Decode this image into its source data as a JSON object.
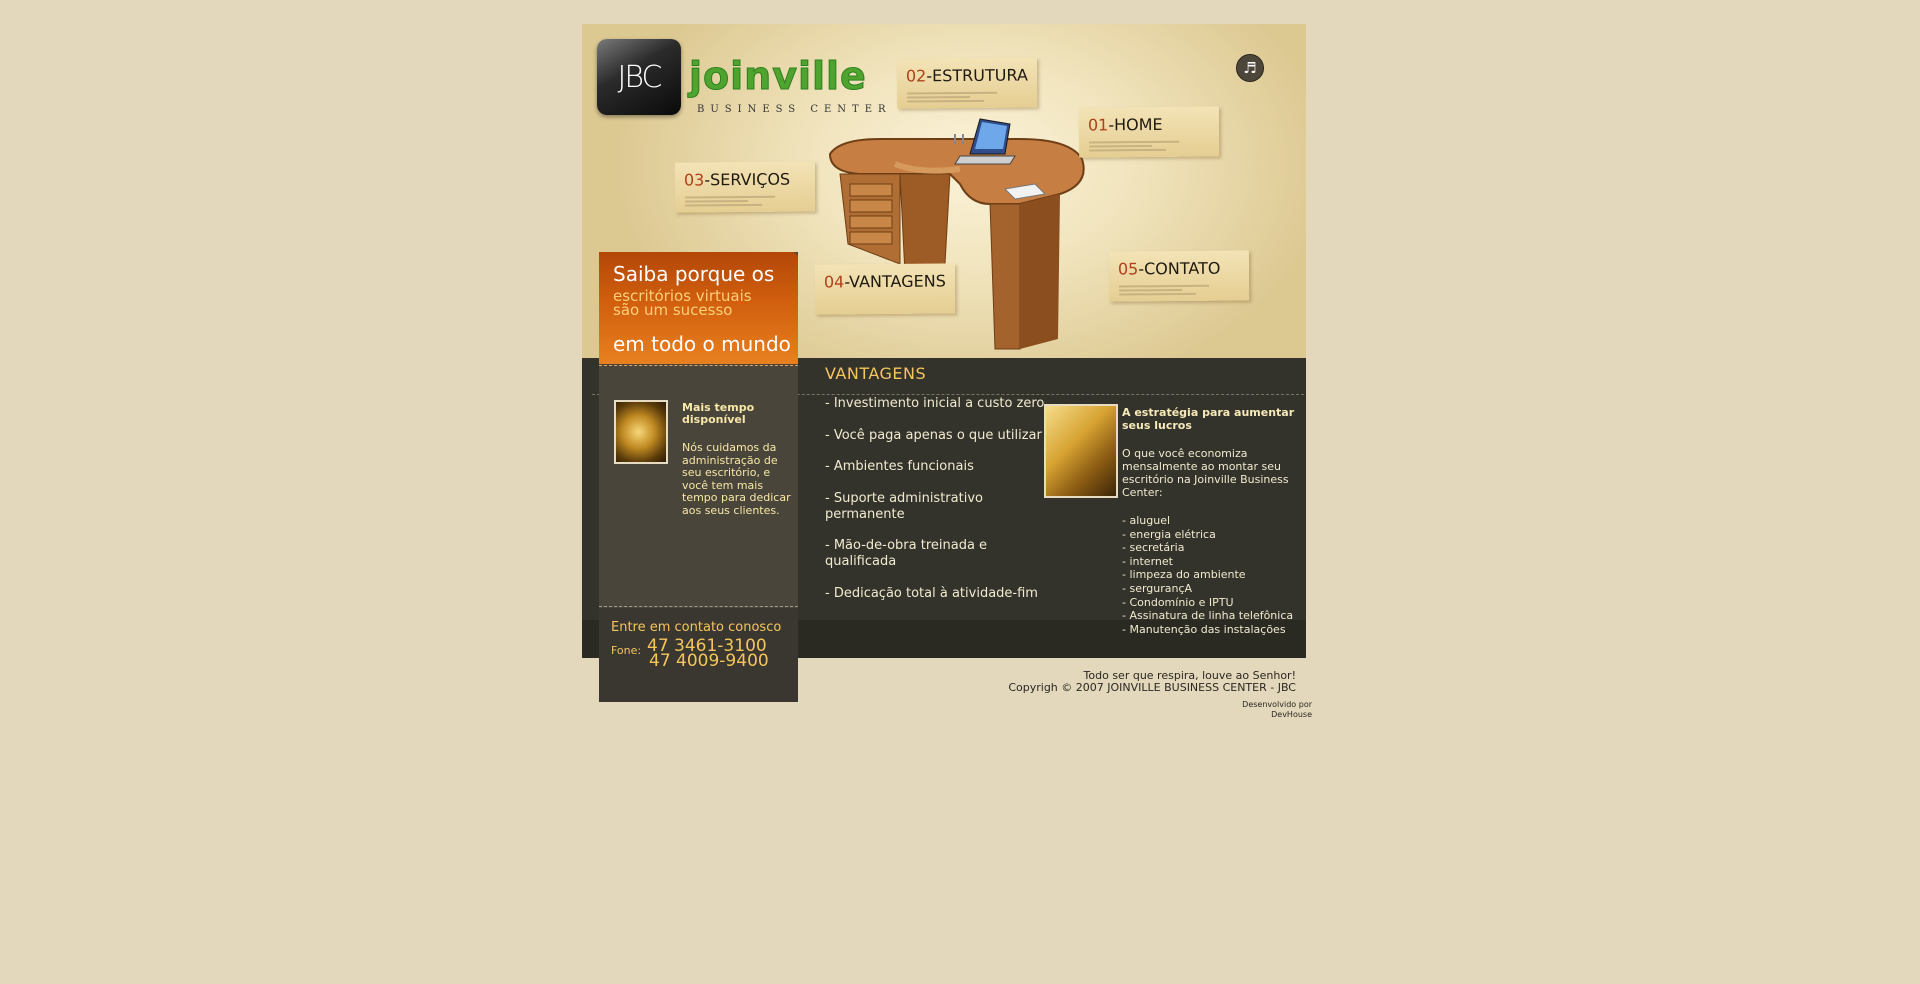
{
  "header": {
    "logo_mark": "JBC",
    "logo_name": "joinville",
    "logo_sub": "BUSINESS CENTER",
    "music_icon": "music-note-icon"
  },
  "nav": [
    {
      "num": "02",
      "label": "ESTRUTURA"
    },
    {
      "num": "01",
      "label": "HOME"
    },
    {
      "num": "03",
      "label": "SERVIÇOS"
    },
    {
      "num": "04",
      "label": "VANTAGENS"
    },
    {
      "num": "05",
      "label": "CONTATO"
    }
  ],
  "promo": {
    "line1": "Saiba porque os",
    "line2a": "escritórios virtuais",
    "line2b": "são um sucesso",
    "line3": "em todo o mundo"
  },
  "left_feature": {
    "title": "Mais tempo disponível",
    "text": "Nós cuidamos da administração de seu escritório, e você tem mais tempo para dedicar aos seus clientes."
  },
  "contact": {
    "title": "Entre em contato conosco",
    "fone_label": "Fone:",
    "phone1": "47 3461-3100",
    "phone2": "47 4009-9400"
  },
  "vantagens": {
    "title": "VANTAGENS",
    "items": [
      "- Investimento inicial a custo zero",
      "- Você paga apenas o que utilizar",
      "- Ambientes funcionais",
      "- Suporte administrativo permanente",
      "- Mão-de-obra treinada e qualificada",
      "- Dedicação total à atividade-fim"
    ]
  },
  "strategy": {
    "title": "A estratégia para aumentar seus lucros",
    "intro": "O que você economiza mensalmente ao montar seu escritório na Joinville Business Center:",
    "items": [
      "- aluguel",
      "- energia elétrica",
      "- secretária",
      "- internet",
      "- limpeza do ambiente",
      "- sergurançA",
      "- Condomínio e IPTU",
      "- Assinatura de linha telefônica",
      "- Manutenção das instalações"
    ]
  },
  "footer": {
    "line1": "Todo ser que respira, louve ao Senhor!",
    "line2": "Copyrigh © 2007 JOINVILLE BUSINESS CENTER - JBC",
    "dev1": "Desenvolvido por",
    "dev2": "DevHouse"
  }
}
